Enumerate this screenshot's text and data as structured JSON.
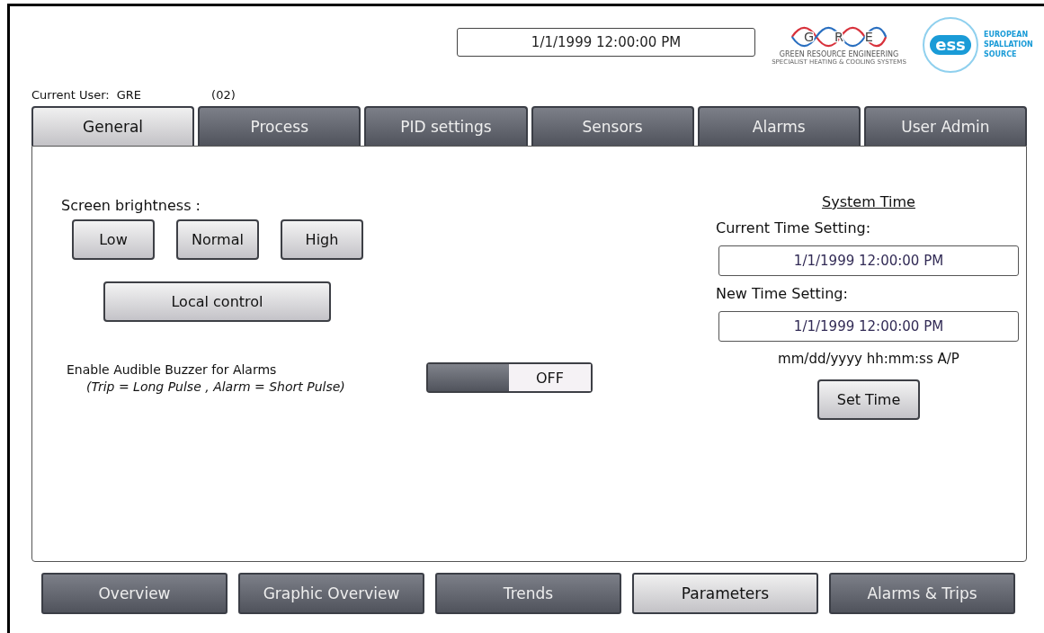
{
  "header": {
    "datetime": "1/1/1999 12:00:00 PM",
    "gre_logo": {
      "letters": [
        "G",
        "R",
        "E"
      ],
      "name": "GREEN RESOURCE ENGINEERING",
      "tagline": "SPECIALIST HEATING & COOLING SYSTEMS"
    },
    "ess_logo": {
      "mark": "ess",
      "name_lines": [
        "EUROPEAN",
        "SPALLATION",
        "SOURCE"
      ]
    }
  },
  "user": {
    "label": "Current User:",
    "name": "GRE",
    "level": "(02)"
  },
  "tabs": [
    {
      "label": "General",
      "selected": true
    },
    {
      "label": "Process",
      "selected": false
    },
    {
      "label": "PID settings",
      "selected": false
    },
    {
      "label": "Sensors",
      "selected": false
    },
    {
      "label": "Alarms",
      "selected": false
    },
    {
      "label": "User Admin",
      "selected": false
    }
  ],
  "general": {
    "brightness_label": "Screen brightness :",
    "brightness_buttons": [
      "Low",
      "Normal",
      "High"
    ],
    "local_control": "Local control",
    "buzzer_label": "Enable Audible Buzzer for Alarms",
    "buzzer_note": "(Trip = Long Pulse , Alarm = Short Pulse)",
    "buzzer_toggle": {
      "on": false,
      "label": "OFF"
    }
  },
  "system_time": {
    "title": "System Time",
    "current_label": "Current Time Setting:",
    "current_value": "1/1/1999 12:00:00 PM",
    "new_label": "New Time Setting:",
    "new_value": "1/1/1999 12:00:00 PM",
    "format": "mm/dd/yyyy hh:mm:ss A/P",
    "button": "Set Time"
  },
  "nav": [
    {
      "label": "Overview",
      "selected": false
    },
    {
      "label": "Graphic Overview",
      "selected": false
    },
    {
      "label": "Trends",
      "selected": false
    },
    {
      "label": "Parameters",
      "selected": true
    },
    {
      "label": "Alarms & Trips",
      "selected": false
    }
  ]
}
